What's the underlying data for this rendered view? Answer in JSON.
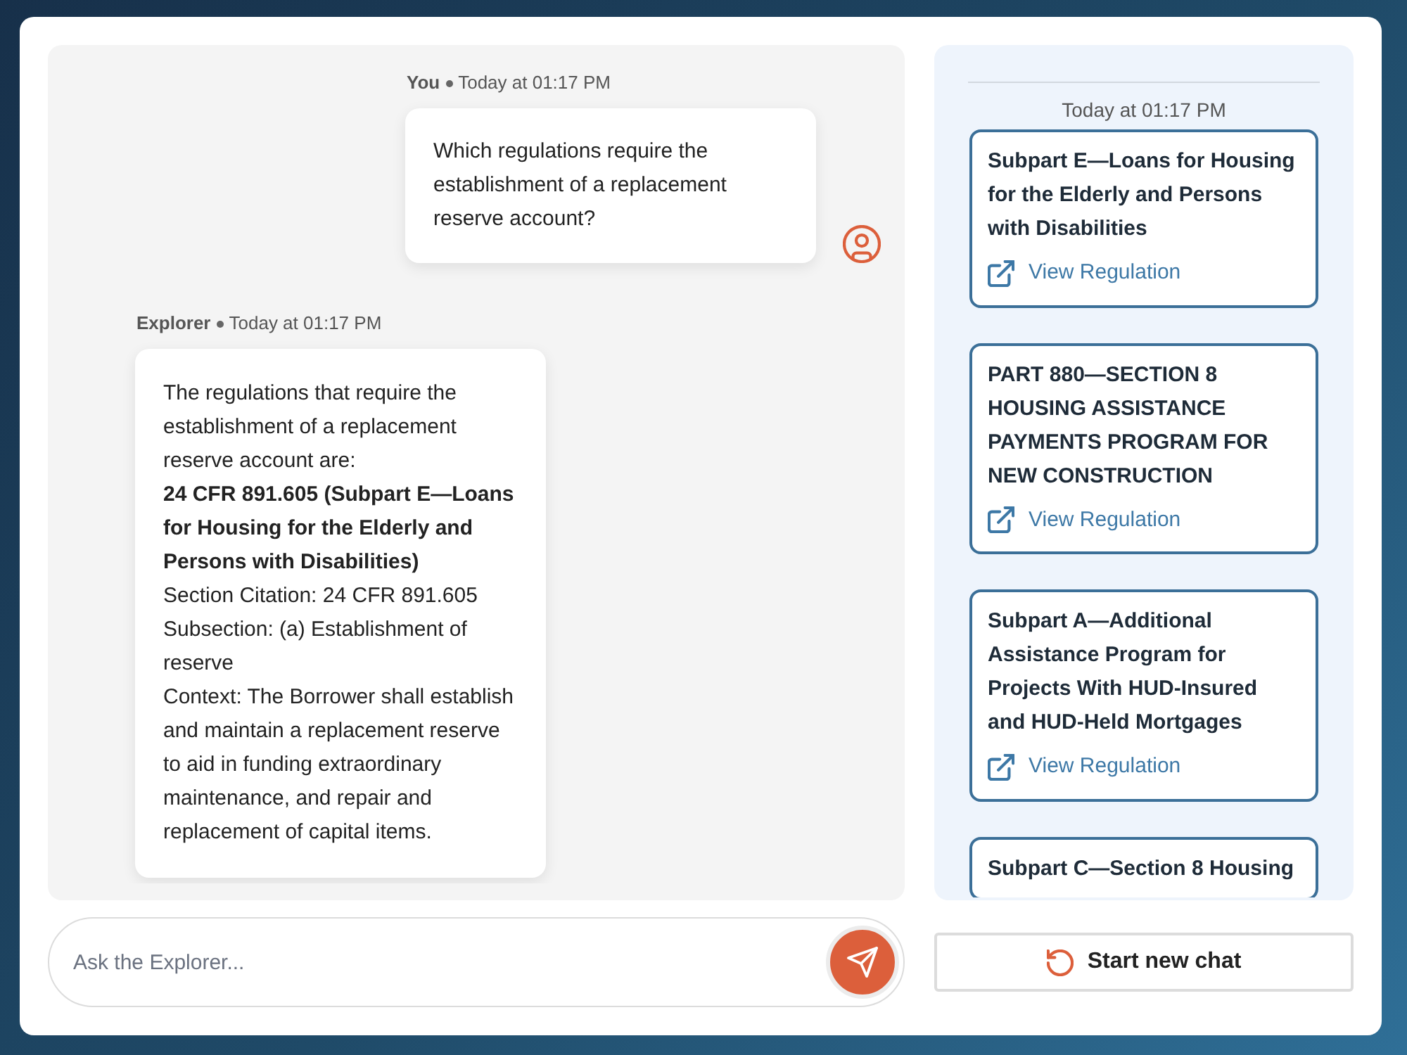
{
  "chat": {
    "messages": [
      {
        "kind": "user",
        "author": "You",
        "time": "Today at 01:17 PM",
        "paragraphs": [
          {
            "kind": "plain",
            "text": "Which regulations require the establishment of a replacement reserve account?"
          }
        ]
      },
      {
        "kind": "assistant",
        "author": "Explorer",
        "time": "Today at 01:17 PM",
        "paragraphs": [
          {
            "kind": "plain",
            "text": "The regulations that require the establishment of a replacement reserve account are:"
          },
          {
            "kind": "heading",
            "text": "24 CFR 891.605 (Subpart E—Loans for Housing for the Elderly and Persons with Disabilities)"
          },
          {
            "kind": "plain",
            "text": "Section Citation: 24 CFR 891.605"
          },
          {
            "kind": "plain",
            "text": "Subsection: (a) Establishment of reserve"
          },
          {
            "kind": "plain",
            "text": "Context: The Borrower shall establish and maintain a replacement reserve to aid in funding extraordinary maintenance, and repair and replacement of capital items."
          }
        ]
      }
    ]
  },
  "input": {
    "placeholder": "Ask the Explorer..."
  },
  "sources": {
    "time": "Today at 01:17 PM",
    "cards": [
      {
        "title": "Subpart E—Loans for Housing for the Elderly and Persons with Disabilities",
        "link": "View Regulation"
      },
      {
        "title": "PART 880—SECTION 8 HOUSING ASSISTANCE PAYMENTS PROGRAM FOR NEW CONSTRUCTION",
        "link": "View Regulation"
      },
      {
        "title": "Subpart A—Additional Assistance Program for Projects With HUD-Insured and HUD-Held Mortgages",
        "link": "View Regulation"
      },
      {
        "title": "Subpart C—Section 8 Housing"
      }
    ]
  },
  "new_chat_button": {
    "label": "Start new chat"
  }
}
